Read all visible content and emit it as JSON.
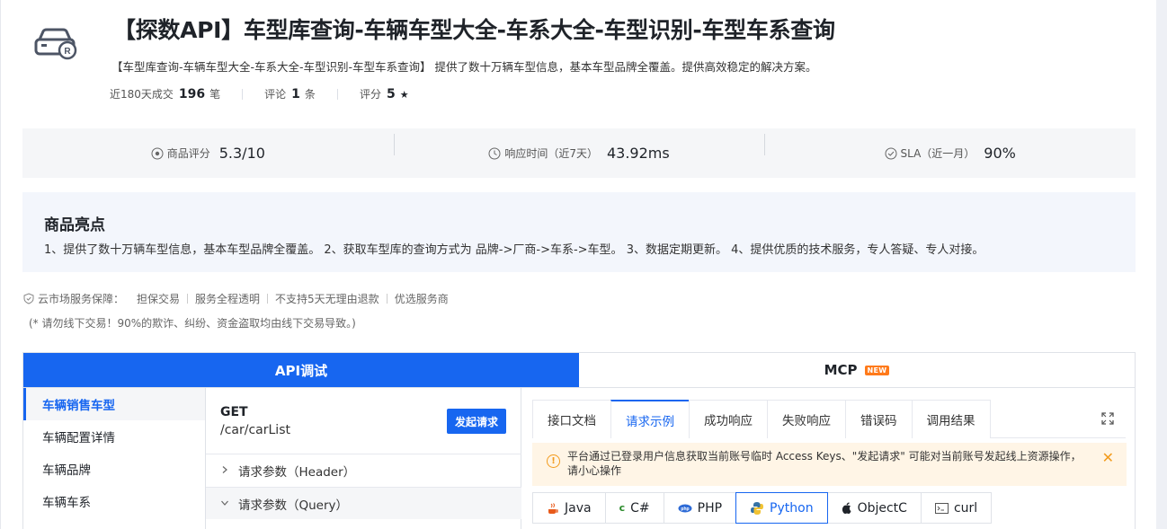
{
  "product": {
    "title": "【探数API】车型库查询-车辆车型大全-车系大全-车型识别-车型车系查询",
    "description": "【车型库查询-车辆车型大全-车系大全-车型识别-车型车系查询】 提供了数十万辆车型信息，基本车型品牌全覆盖。提供高效稳定的解决方案。",
    "stats": {
      "deals_label": "近180天成交",
      "deals_value": "196",
      "deals_unit": "笔",
      "reviews_label": "评论",
      "reviews_value": "1",
      "reviews_unit": "条",
      "rating_label": "评分",
      "rating_value": "5",
      "rating_star": "★"
    }
  },
  "metrics": {
    "score_label": "商品评分",
    "score_value": "5.3/10",
    "response_label": "响应时间（近7天）",
    "response_value": "43.92ms",
    "sla_label": "SLA（近一月）",
    "sla_value": "90%"
  },
  "highlights": {
    "title": "商品亮点",
    "text": "1、提供了数十万辆车型信息，基本车型品牌全覆盖。 2、获取车型库的查询方式为 品牌->厂商->车系->车型。 3、数据定期更新。 4、提供优质的技术服务，专人答疑、专人对接。"
  },
  "guarantee": {
    "label": "云市场服务保障：",
    "items": [
      "担保交易",
      "服务全程透明",
      "不支持5天无理由退款",
      "优选服务商"
    ],
    "warning": "(* 请勿线下交易！90%的欺诈、纠纷、资金盗取均由线下交易导致。)"
  },
  "api_tabs": {
    "debug": "API调试",
    "mcp": "MCP",
    "new_badge": "NEW"
  },
  "sidebar": {
    "items": [
      "车辆销售车型",
      "车辆配置详情",
      "车辆品牌",
      "车辆车系"
    ]
  },
  "endpoint": {
    "method": "GET",
    "path": "/car/carList",
    "send_label": "发起请求",
    "header_params": "请求参数（Header）",
    "query_params": "请求参数（Query）"
  },
  "right_tabs": [
    "接口文档",
    "请求示例",
    "成功响应",
    "失败响应",
    "错误码",
    "调用结果"
  ],
  "notice": "平台通过已登录用户信息获取当前账号临时 Access Keys、\"发起请求\" 可能对当前账号发起线上资源操作，请小心操作",
  "languages": [
    "Java",
    "C#",
    "PHP",
    "Python",
    "ObjectC",
    "curl"
  ],
  "colors": {
    "accent": "#1766f0",
    "new_badge": "#ff7a1a",
    "notice_bg": "#fff5e6",
    "notice_icon": "#f29b1d"
  }
}
